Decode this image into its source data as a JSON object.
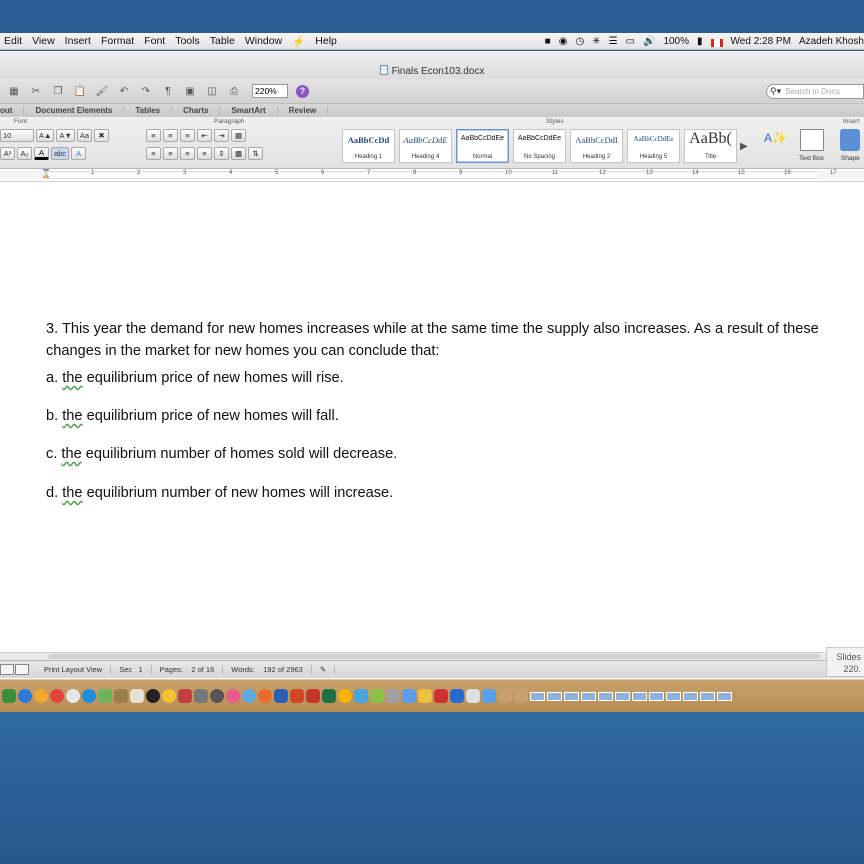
{
  "menubar": {
    "items": [
      "Edit",
      "View",
      "Insert",
      "Format",
      "Font",
      "Tools",
      "Table",
      "Window",
      "Help"
    ],
    "battery": "100%",
    "datetime": "Wed 2:28 PM",
    "user": "Azadeh Khosh"
  },
  "window": {
    "title": "Finals Econ103.docx"
  },
  "toolbar": {
    "zoom": "220%",
    "search_placeholder": "Search in Docu"
  },
  "ribbon": {
    "tabs": [
      "out",
      "Document Elements",
      "Tables",
      "Charts",
      "SmartArt",
      "Review"
    ],
    "groups": {
      "font": "Font",
      "paragraph": "Paragraph",
      "styles": "Styles",
      "insert": "Insert"
    },
    "font_size": "10",
    "styles": [
      {
        "sample": "AaBbCcDd",
        "name": "Heading 1"
      },
      {
        "sample": "AaBbCcDdE",
        "name": "Heading 4"
      },
      {
        "sample": "AaBbCcDdEe",
        "name": "Normal"
      },
      {
        "sample": "AaBbCcDdEe",
        "name": "No Spacing"
      },
      {
        "sample": "AaBbCcDdI",
        "name": "Heading 2"
      },
      {
        "sample": "AaBbCcDdEe",
        "name": "Heading 5"
      },
      {
        "sample": "AaBb(",
        "name": "Title"
      }
    ],
    "text_box": "Text Box",
    "shapes": "Shape"
  },
  "ruler": {
    "ticks": [
      "1",
      "2",
      "3",
      "4",
      "5",
      "6",
      "7",
      "8",
      "9",
      "10",
      "11",
      "12",
      "13",
      "14",
      "15",
      "16",
      "17"
    ]
  },
  "document": {
    "question": "3. This year the demand for new homes increases while at the same time the supply also increases. As a result of these changes in the market for new homes you can conclude that:",
    "options": [
      {
        "prefix": "a.",
        "the": "the",
        "rest": "equilibrium price of new homes will rise."
      },
      {
        "prefix": "b.",
        "the": "the",
        "rest": "equilibrium price of new homes will fall."
      },
      {
        "prefix": "c.",
        "the": "the",
        "rest": "equilibrium number of homes sold will decrease."
      },
      {
        "prefix": "d.",
        "the": "the",
        "rest": "equilibrium number of new homes will increase."
      }
    ]
  },
  "status": {
    "view": "Print Layout View",
    "sec_label": "Sec",
    "sec_value": "1",
    "pages_label": "Pages:",
    "pages_value": "2 of 16",
    "words_label": "Words:",
    "words_value": "192 of 2963",
    "slides": "Slides",
    "zoom": "220."
  }
}
